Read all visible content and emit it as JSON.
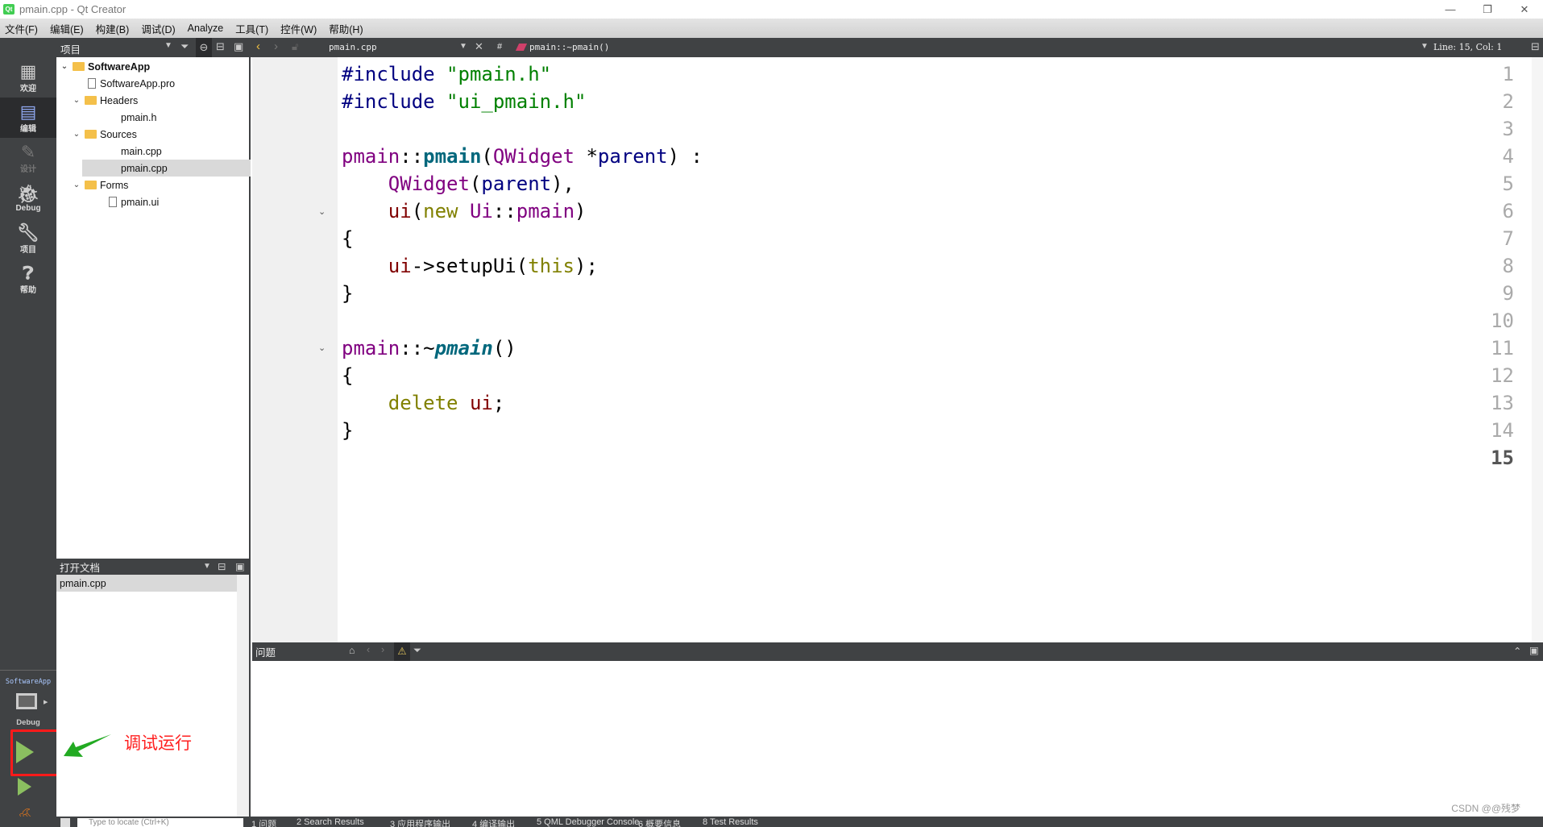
{
  "window": {
    "title": "pmain.cpp - Qt Creator",
    "minimize": "—",
    "maximize": "❐",
    "close": "✕"
  },
  "menu": [
    "文件(F)",
    "编辑(E)",
    "构建(B)",
    "调试(D)",
    "Analyze",
    "工具(T)",
    "控件(W)",
    "帮助(H)"
  ],
  "modes": [
    {
      "label": "欢迎",
      "icon": "grid-icon"
    },
    {
      "label": "编辑",
      "icon": "edit-icon"
    },
    {
      "label": "设计",
      "icon": "pencil-icon"
    },
    {
      "label": "Debug",
      "icon": "bug-icon"
    },
    {
      "label": "项目",
      "icon": "wrench-icon"
    },
    {
      "label": "帮助",
      "icon": "help-icon"
    }
  ],
  "project_pane": {
    "title": "项目",
    "tree": [
      {
        "label": "SoftwareApp",
        "level": 0,
        "kind": "project"
      },
      {
        "label": "SoftwareApp.pro",
        "level": 1,
        "kind": "file"
      },
      {
        "label": "Headers",
        "level": 1,
        "kind": "folder"
      },
      {
        "label": "pmain.h",
        "level": 2,
        "kind": "file"
      },
      {
        "label": "Sources",
        "level": 1,
        "kind": "folder"
      },
      {
        "label": "main.cpp",
        "level": 2,
        "kind": "file"
      },
      {
        "label": "pmain.cpp",
        "level": 2,
        "kind": "file",
        "selected": true
      },
      {
        "label": "Forms",
        "level": 1,
        "kind": "folder"
      },
      {
        "label": "pmain.ui",
        "level": 2,
        "kind": "file"
      }
    ]
  },
  "open_documents": {
    "title": "打开文档",
    "items": [
      "pmain.cpp"
    ]
  },
  "editor_toolbar": {
    "file": "pmain.cpp",
    "hash": "#",
    "symbol": "pmain::~pmain()",
    "position": "Line: 15, Col: 1"
  },
  "code": {
    "lines": [
      "1",
      "2",
      "3",
      "4",
      "5",
      "6",
      "7",
      "8",
      "9",
      "10",
      "11",
      "12",
      "13",
      "14",
      "15"
    ],
    "current_line": "15"
  },
  "output_pane": {
    "title": "问题"
  },
  "kit": {
    "project": "SoftwareApp",
    "build": "Debug"
  },
  "annotation": {
    "text": "调试运行",
    "color": "#ff2020"
  },
  "status_bar": {
    "search_placeholder": "Type to locate (Ctrl+K)",
    "tabs": [
      "1 问题",
      "2 Search Results",
      "3 应用程序输出",
      "4 编译输出",
      "5 QML Debugger Console",
      "6 概要信息",
      "8 Test Results"
    ]
  },
  "watermark": "CSDN @@残梦"
}
